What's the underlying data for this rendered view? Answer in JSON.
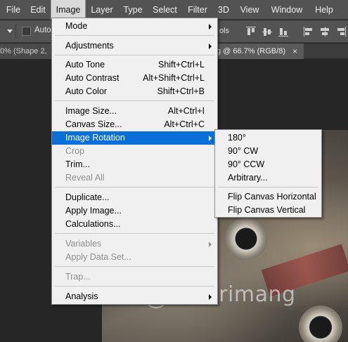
{
  "menubar": {
    "items": [
      {
        "label": "File"
      },
      {
        "label": "Edit"
      },
      {
        "label": "Image"
      },
      {
        "label": "Layer"
      },
      {
        "label": "Type"
      },
      {
        "label": "Select"
      },
      {
        "label": "Filter"
      },
      {
        "label": "3D"
      },
      {
        "label": "View"
      },
      {
        "label": "Window"
      },
      {
        "label": "Help"
      }
    ]
  },
  "options": {
    "auto_label": "Auto-",
    "right_label": "ols"
  },
  "tabs": {
    "left": "0% (Shape 2,",
    "right": "g @ 66.7% (RGB/8)",
    "close": "×"
  },
  "image_menu": {
    "mode": "Mode",
    "adjustments": "Adjustments",
    "auto_tone": {
      "label": "Auto Tone",
      "shortcut": "Shift+Ctrl+L"
    },
    "auto_contrast": {
      "label": "Auto Contrast",
      "shortcut": "Alt+Shift+Ctrl+L"
    },
    "auto_color": {
      "label": "Auto Color",
      "shortcut": "Shift+Ctrl+B"
    },
    "image_size": {
      "label": "Image Size...",
      "shortcut": "Alt+Ctrl+I"
    },
    "canvas_size": {
      "label": "Canvas Size...",
      "shortcut": "Alt+Ctrl+C"
    },
    "image_rotation": "Image Rotation",
    "crop": "Crop",
    "trim": "Trim...",
    "reveal_all": "Reveal All",
    "duplicate": "Duplicate...",
    "apply_image": "Apply Image...",
    "calculations": "Calculations...",
    "variables": "Variables",
    "apply_data_set": "Apply Data Set...",
    "trap": "Trap...",
    "analysis": "Analysis"
  },
  "rotation_menu": {
    "r180": "180°",
    "r90cw": "90° CW",
    "r90ccw": "90° CCW",
    "arbitrary": "Arbitrary...",
    "flip_h": "Flip Canvas Horizontal",
    "flip_v": "Flip Canvas Vertical"
  },
  "watermark": "uantrimang",
  "colors": {
    "highlight": "#0a6fd6",
    "menu_bg": "#f0f0f0",
    "app_bg": "#535353"
  }
}
